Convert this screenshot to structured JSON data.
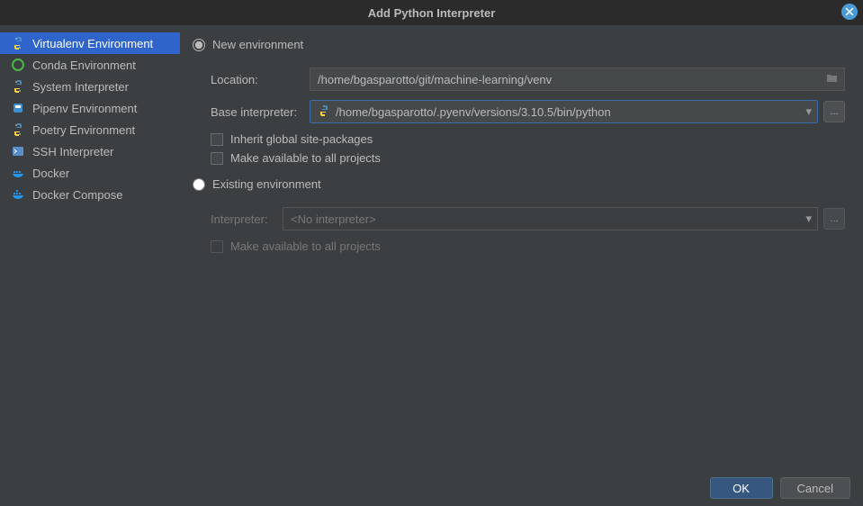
{
  "window": {
    "title": "Add Python Interpreter"
  },
  "sidebar": {
    "items": [
      {
        "label": "Virtualenv Environment"
      },
      {
        "label": "Conda Environment"
      },
      {
        "label": "System Interpreter"
      },
      {
        "label": "Pipenv Environment"
      },
      {
        "label": "Poetry Environment"
      },
      {
        "label": "SSH Interpreter"
      },
      {
        "label": "Docker"
      },
      {
        "label": "Docker Compose"
      }
    ]
  },
  "content": {
    "new_env_label": "New environment",
    "existing_env_label": "Existing environment",
    "location_label": "Location:",
    "location_value": "/home/bgasparotto/git/machine-learning/venv",
    "base_interp_label": "Base interpreter:",
    "base_interp_value": "/home/bgasparotto/.pyenv/versions/3.10.5/bin/python",
    "inherit_label": "Inherit global site-packages",
    "make_avail_label": "Make available to all projects",
    "interpreter_label": "Interpreter:",
    "interpreter_placeholder": "<No interpreter>",
    "make_avail_label2": "Make available to all projects"
  },
  "footer": {
    "ok": "OK",
    "cancel": "Cancel"
  }
}
